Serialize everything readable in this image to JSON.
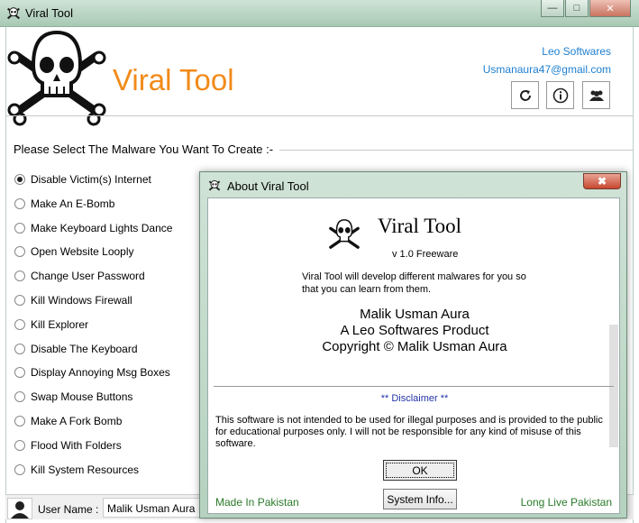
{
  "window": {
    "title": "Viral Tool",
    "minimize_label": "—",
    "maximize_label": "□",
    "close_label": "✕"
  },
  "header": {
    "app_name": "Viral Tool",
    "company": "Leo Softwares",
    "email": "Usmanaura47@gmail.com",
    "icons": [
      "refresh-icon",
      "info-icon",
      "users-icon"
    ]
  },
  "malware_group": {
    "label": "Please Select The Malware You Want To Create :-",
    "options": [
      {
        "label": "Disable Victim(s) Internet",
        "checked": true
      },
      {
        "label": "Make An E-Bomb",
        "checked": false
      },
      {
        "label": "Make Keyboard Lights Dance",
        "checked": false
      },
      {
        "label": "Open Website Looply",
        "checked": false
      },
      {
        "label": "Change User Password",
        "checked": false
      },
      {
        "label": "Kill Windows Firewall",
        "checked": false
      },
      {
        "label": "Kill Explorer",
        "checked": false
      },
      {
        "label": "Disable The Keyboard",
        "checked": false
      },
      {
        "label": "Display Annoying Msg Boxes",
        "checked": false
      },
      {
        "label": "Swap Mouse Buttons",
        "checked": false
      },
      {
        "label": "Make A Fork Bomb",
        "checked": false
      },
      {
        "label": "Flood With Folders",
        "checked": false
      },
      {
        "label": "Kill System Resources",
        "checked": false
      }
    ]
  },
  "status": {
    "user_label": "User Name :",
    "user_value": "Malik Usman Aura"
  },
  "about": {
    "title": "About Viral Tool",
    "close_label": "✖",
    "app_name": "Viral Tool",
    "version": "v 1.0 Freeware",
    "description": "Viral Tool will develop different malwares for you so that you can learn from them.",
    "author": "Malik Usman Aura",
    "product": "A Leo Softwares Product",
    "copyright": "Copyright © Malik Usman Aura",
    "disclaimer_title": "** Disclaimer **",
    "disclaimer_text": "This software is not intended to be used for illegal purposes and is provided to the public for educational purposes only. I will not be responsible for any kind of misuse of this software.",
    "ok_label": "OK",
    "system_info_label": "System Info...",
    "made_in": "Made In Pakistan",
    "long_live": "Long Live Pakistan"
  }
}
